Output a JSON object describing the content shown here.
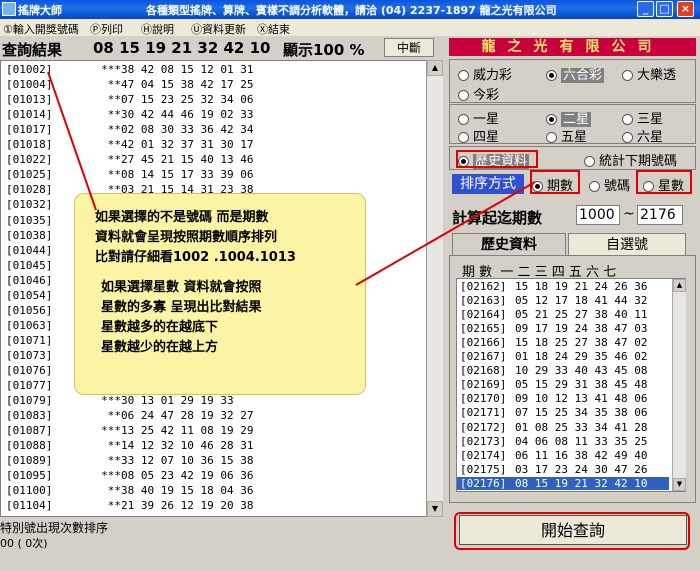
{
  "window": {
    "title": "搖牌大師",
    "banner": "各種類型搖牌、算牌、賓樣不調分析軟體，請洽 (04) 2237-1897  龍之光有限公司",
    "buttons": [
      "_",
      "□",
      "×"
    ]
  },
  "menu": [
    "①輸入開獎號碼",
    "Ⓟ列印",
    "Ⓗ說明",
    "Ⓤ資料更新",
    "Ⓧ結束"
  ],
  "header": {
    "title": "查詢結果",
    "numbers": "08 15 19 21 32 42 10",
    "display_label": "顯示100 %",
    "mid_button": "中斷"
  },
  "results": [
    {
      "id": "[01002]",
      "stars": "***",
      "nums": "38 42 08 15 12 01 31"
    },
    {
      "id": "[01004]",
      "stars": "**",
      "nums": "47 04 15 38 42 17 25"
    },
    {
      "id": "[01013]",
      "stars": "**",
      "nums": "07 15 23 25 32 34 06"
    },
    {
      "id": "[01014]",
      "stars": "**",
      "nums": "30 42 44 46 19 02 33"
    },
    {
      "id": "[01017]",
      "stars": "**",
      "nums": "02 08 30 33 36 42 34"
    },
    {
      "id": "[01018]",
      "stars": "**",
      "nums": "42 01 32 37 31 30 17"
    },
    {
      "id": "[01022]",
      "stars": "**",
      "nums": "27 45 21 15 40 13 46"
    },
    {
      "id": "[01025]",
      "stars": "**",
      "nums": "08 14 15 17 33 39 06"
    },
    {
      "id": "[01028]",
      "stars": "**",
      "nums": "03 21 15 14 31 23 38"
    },
    {
      "id": "[01032]",
      "stars": "",
      "nums": ""
    },
    {
      "id": "[01035]",
      "stars": "",
      "nums": ""
    },
    {
      "id": "[01038]",
      "stars": "",
      "nums": ""
    },
    {
      "id": "[01044]",
      "stars": "",
      "nums": ""
    },
    {
      "id": "[01045]",
      "stars": "",
      "nums": ""
    },
    {
      "id": "[01046]",
      "stars": "",
      "nums": ""
    },
    {
      "id": "[01054]",
      "stars": "",
      "nums": ""
    },
    {
      "id": "[01056]",
      "stars": "",
      "nums": ""
    },
    {
      "id": "[01063]",
      "stars": "",
      "nums": ""
    },
    {
      "id": "[01071]",
      "stars": "",
      "nums": ""
    },
    {
      "id": "[01073]",
      "stars": "",
      "nums": ""
    },
    {
      "id": "[01076]",
      "stars": "",
      "nums": ""
    },
    {
      "id": "[01077]",
      "stars": "",
      "nums": ""
    },
    {
      "id": "[01079]",
      "stars": "***",
      "nums": "30 13 01 29 19 33"
    },
    {
      "id": "[01083]",
      "stars": "**",
      "nums": "06 24 47 28 19 32 27"
    },
    {
      "id": "[01087]",
      "stars": "***",
      "nums": "13 25 42 11 08 19 29"
    },
    {
      "id": "[01088]",
      "stars": "**",
      "nums": "14 12 32 10 46 28 31"
    },
    {
      "id": "[01089]",
      "stars": "**",
      "nums": "33 12 07 10 36 15 38"
    },
    {
      "id": "[01095]",
      "stars": "***",
      "nums": "08 05 23 42 19 06 36"
    },
    {
      "id": "[01100]",
      "stars": "**",
      "nums": "38 40 19 15 18 04 36"
    },
    {
      "id": "[01104]",
      "stars": "**",
      "nums": "21 39 26 12 19 20 38"
    }
  ],
  "status": {
    "line1": "特別號出現次數排序",
    "line2": "00  (   0次)"
  },
  "note": {
    "lines": [
      "如果選擇的不是號碼 而是期數",
      "資料就會呈現按照期數順序排列",
      "比對請仔細看1002 .1004.1013",
      "如果選擇星數 資料就會按照",
      "星數的多寡 呈現出比對結果",
      "星數越多的在越底下",
      "星數越少的在越上方"
    ]
  },
  "right": {
    "company": "龍之光有限公司",
    "games": [
      {
        "label": "威力彩",
        "on": false
      },
      {
        "label": "六合彩",
        "on": true
      },
      {
        "label": "大樂透",
        "on": false
      },
      {
        "label": "今彩",
        "on": false
      }
    ],
    "stars": [
      {
        "label": "一星",
        "on": false
      },
      {
        "label": "二星",
        "on": true
      },
      {
        "label": "三星",
        "on": false
      },
      {
        "label": "四星",
        "on": false
      },
      {
        "label": "五星",
        "on": false
      },
      {
        "label": "六星",
        "on": false
      }
    ],
    "mode": [
      {
        "label": "歷史資料",
        "on": true
      },
      {
        "label": "統計下期號碼",
        "on": false
      }
    ],
    "sort_label": "排序方式",
    "sort": [
      {
        "label": "期數",
        "on": true
      },
      {
        "label": "號碼",
        "on": false
      },
      {
        "label": "星數",
        "on": false
      }
    ],
    "range_label": "計算起迄期數",
    "range_from": "1000",
    "range_sep": "~",
    "range_to": "2176",
    "tabs": [
      "歷史資料",
      "自選號"
    ],
    "hist_header": "期 數  一 二 三 四 五 六 七",
    "history": [
      {
        "id": "[02162]",
        "nums": "15 18 19 21 24 26 36"
      },
      {
        "id": "[02163]",
        "nums": "05 12 17 18 41 44 32"
      },
      {
        "id": "[02164]",
        "nums": "05 21 25 27 38 40 11"
      },
      {
        "id": "[02165]",
        "nums": "09 17 19 24 38 47 03"
      },
      {
        "id": "[02166]",
        "nums": "15 18 25 27 38 47 02"
      },
      {
        "id": "[02167]",
        "nums": "01 18 24 29 35 46 02"
      },
      {
        "id": "[02168]",
        "nums": "10 29 33 40 43 45 08"
      },
      {
        "id": "[02169]",
        "nums": "05 15 29 31 38 45 48"
      },
      {
        "id": "[02170]",
        "nums": "09 10 12 13 41 48 06"
      },
      {
        "id": "[02171]",
        "nums": "07 15 25 34 35 38 06"
      },
      {
        "id": "[02172]",
        "nums": "01 08 25 33 34 41 28"
      },
      {
        "id": "[02173]",
        "nums": "04 06 08 11 33 35 25"
      },
      {
        "id": "[02174]",
        "nums": "06 11 16 38 42 49 40"
      },
      {
        "id": "[02175]",
        "nums": "03 17 23 24 30 47 26"
      },
      {
        "id": "[02176]",
        "nums": "08 15 19 21 32 42 10"
      }
    ],
    "start_button": "開始查詢"
  }
}
